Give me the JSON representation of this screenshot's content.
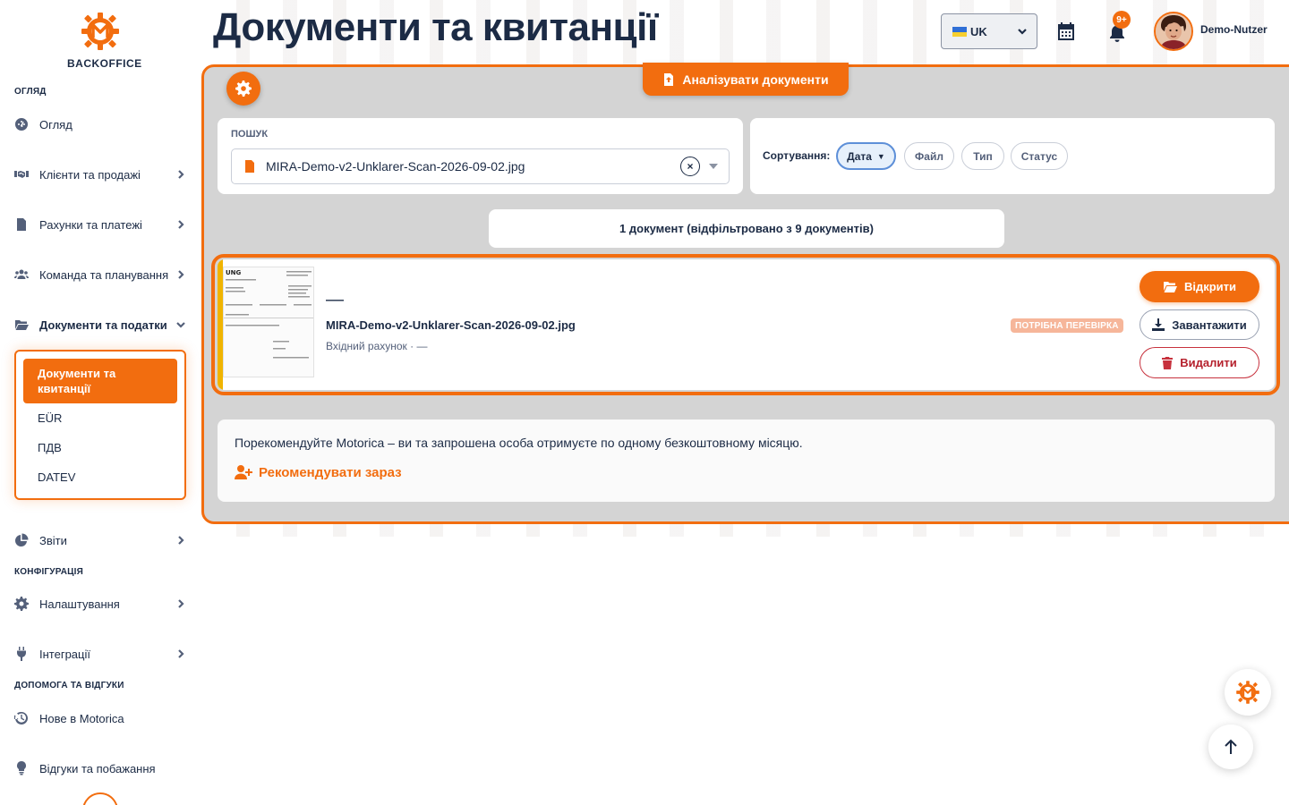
{
  "brand": {
    "name": "BACKOFFICE",
    "accent": "#f26d0f"
  },
  "header": {
    "title": "Документи та квитанції",
    "language": "UK",
    "notification_count": "9+",
    "user_name": "Demo-Nutzer"
  },
  "sidebar": {
    "sections": {
      "overview": "ОГЛЯД",
      "configuration": "КОНФІГУРАЦІЯ",
      "help": "ДОПОМОГА ТА ВІДГУКИ"
    },
    "items": [
      {
        "label": "Огляд",
        "icon": "dashboard-icon"
      },
      {
        "label": "Клієнти та продажі",
        "icon": "handshake-icon"
      },
      {
        "label": "Рахунки та платежі",
        "icon": "invoice-icon"
      },
      {
        "label": "Команда та планування",
        "icon": "users-icon"
      },
      {
        "label": "Документи та податки",
        "icon": "folder-open-icon"
      },
      {
        "label": "Звіти",
        "icon": "pie-chart-icon"
      },
      {
        "label": "Налаштування",
        "icon": "gear-icon"
      },
      {
        "label": "Інтеграції",
        "icon": "plug-icon"
      },
      {
        "label": "Нове в Motorica",
        "icon": "history-icon"
      },
      {
        "label": "Відгуки та побажання",
        "icon": "lightbulb-icon"
      }
    ],
    "submenu": {
      "active": "Документи та квитанції",
      "items": [
        "EÜR",
        "ПДВ",
        "DATEV"
      ]
    }
  },
  "toolbar": {
    "analyze_label": "Аналізувати документи"
  },
  "search": {
    "label": "ПОШУК",
    "value": "MIRA-Demo-v2-Unklarer-Scan-2026-09-02.jpg",
    "clear_symbol": "×"
  },
  "sort": {
    "label": "Сортування:",
    "options": [
      "Дата",
      "Файл",
      "Тип",
      "Статус"
    ],
    "active": "Дата",
    "arrow": "▼"
  },
  "results_summary": "1 документ (відфільтровано з 9 документів)",
  "documents": [
    {
      "title": "—",
      "file_name": "MIRA-Demo-v2-Unklarer-Scan-2026-09-02.jpg",
      "meta": "Вхідний рахунок · —",
      "status": "ПОТРІБНА ПЕРЕВІРКА",
      "actions": {
        "open": "Відкрити",
        "download": "Завантажити",
        "delete": "Видалити"
      }
    }
  ],
  "referral": {
    "text": "Порекомендуйте Motorica – ви та запрошена особа отримуєте по одному безкоштовному місяцю.",
    "link": "Рекомендувати зараз"
  }
}
